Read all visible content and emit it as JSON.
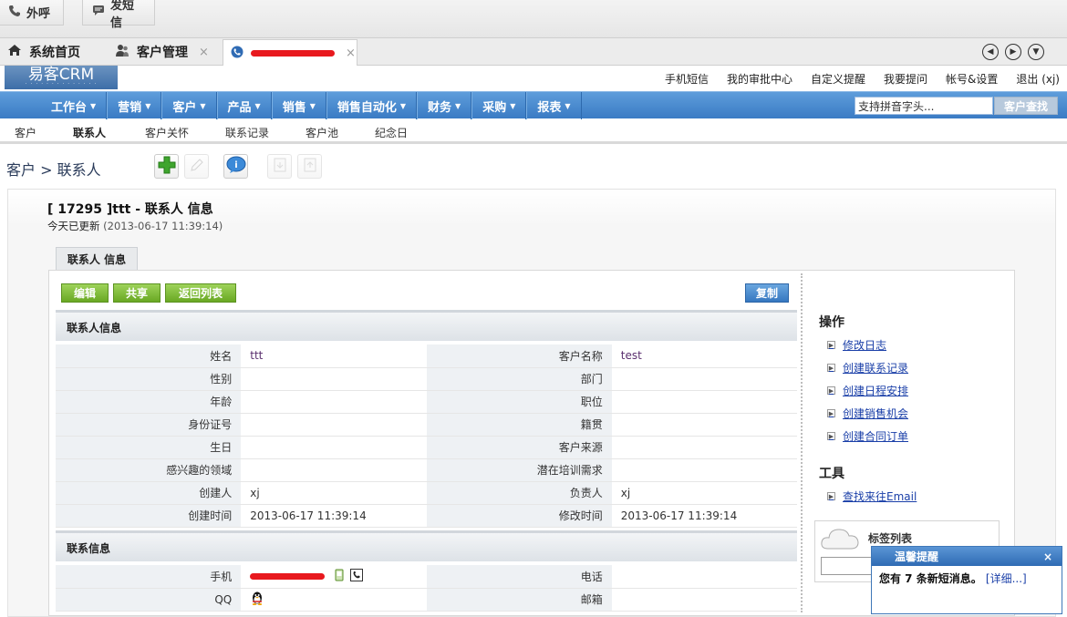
{
  "toolbar": {
    "call_label": "外呼",
    "sms_label": "发短信"
  },
  "tabs": [
    {
      "label": "系统首页"
    },
    {
      "label": "客户管理"
    },
    {
      "label": ""
    }
  ],
  "header": {
    "logo_text": "易客CRM",
    "links": [
      "手机短信",
      "我的审批中心",
      "自定义提醒",
      "我要提问",
      "帐号&设置",
      "退出 (xj)"
    ]
  },
  "mainnav": {
    "items": [
      "工作台",
      "营销",
      "客户",
      "产品",
      "销售",
      "销售自动化",
      "财务",
      "采购",
      "报表"
    ],
    "search_value": "支持拼音字头...",
    "search_button": "客户查找"
  },
  "subnav": {
    "items": [
      "客户",
      "联系人",
      "客户关怀",
      "联系记录",
      "客户池",
      "纪念日"
    ],
    "active_index": 1
  },
  "breadcrumb": "客户 > 联系人",
  "record": {
    "title": "[ 17295 ]ttt - 联系人 信息",
    "updated_prefix": "今天已更新",
    "updated_time": "(2013-06-17 11:39:14)",
    "tab_label": "联系人 信息"
  },
  "actions": {
    "edit": "编辑",
    "share": "共享",
    "back": "返回列表",
    "copy": "复制"
  },
  "section1": {
    "title": "联系人信息",
    "rows": [
      [
        "姓名",
        "ttt",
        "客户名称",
        "test"
      ],
      [
        "性别",
        "",
        "部门",
        ""
      ],
      [
        "年龄",
        "",
        "职位",
        ""
      ],
      [
        "身份证号",
        "",
        "籍贯",
        ""
      ],
      [
        "生日",
        "",
        "客户来源",
        ""
      ],
      [
        "感兴趣的领域",
        "",
        "潜在培训需求",
        ""
      ],
      [
        "创建人",
        "xj",
        "负责人",
        "xj"
      ],
      [
        "创建时间",
        "2013-06-17 11:39:14",
        "修改时间",
        "2013-06-17 11:39:14"
      ]
    ]
  },
  "section2": {
    "title": "联系信息",
    "rows": [
      [
        "手机",
        "",
        "电话",
        ""
      ],
      [
        "QQ",
        "",
        "邮箱",
        ""
      ]
    ]
  },
  "sidebar": {
    "ops_title": "操作",
    "ops": [
      "修改日志",
      "创建联系记录",
      "创建日程安排",
      "创建销售机会",
      "创建合同订单"
    ],
    "tools_title": "工具",
    "tools": [
      "查找来往Email"
    ],
    "tag_title": "标签列表"
  },
  "popup": {
    "title": "温馨提醒",
    "message": "您有 7 条新短消息。",
    "detail": "[详细...]",
    "close": "×"
  },
  "colors": {
    "nav_blue": "#3a7bc4",
    "green_button": "#69a823",
    "blue_button": "#3577c0"
  }
}
